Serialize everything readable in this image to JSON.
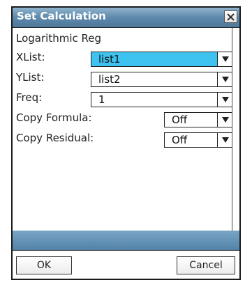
{
  "dialog": {
    "title": "Set Calculation",
    "regression_type": "Logarithmic Reg"
  },
  "fields": {
    "xlist": {
      "label": "XList:",
      "value": "list1"
    },
    "ylist": {
      "label": "YList:",
      "value": "list2"
    },
    "freq": {
      "label": "Freq:",
      "value": "1"
    },
    "copy_formula": {
      "label": "Copy Formula:",
      "value": "Off"
    },
    "copy_residual": {
      "label": "Copy Residual:",
      "value": "Off"
    }
  },
  "buttons": {
    "ok": "OK",
    "cancel": "Cancel"
  },
  "colors": {
    "titlebar": "#5f89ab",
    "selected_field": "#3ec3f0",
    "bottom_band": "#4f7fa6"
  }
}
